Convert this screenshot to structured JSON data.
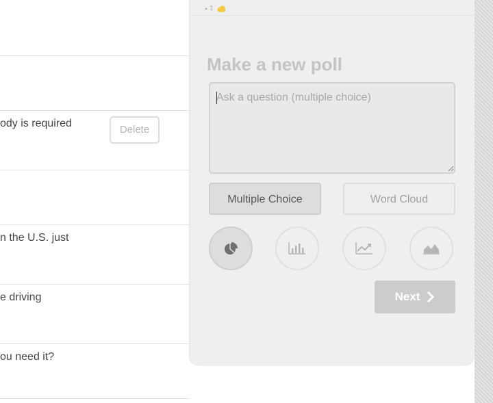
{
  "list": {
    "rows": [
      {
        "text": ""
      },
      {
        "text": ""
      },
      {
        "text": "ody is required",
        "action": "Delete"
      },
      {
        "text": ""
      },
      {
        "text": "n the U.S. just"
      },
      {
        "text": "e driving"
      },
      {
        "text": "ou need it?"
      }
    ]
  },
  "panel": {
    "meta": {
      "caret": "▲",
      "count": "1",
      "icon": "cloud-icon"
    },
    "title": "Make a new poll",
    "question_placeholder": "Ask a question (multiple choice)",
    "question_value": "",
    "types": {
      "multiple_choice": "Multiple Choice",
      "word_cloud": "Word Cloud",
      "selected": "Multiple Choice"
    },
    "chart_types": [
      {
        "icon": "pie-chart-icon",
        "selected": true
      },
      {
        "icon": "bar-chart-icon",
        "selected": false
      },
      {
        "icon": "line-chart-icon",
        "selected": false
      },
      {
        "icon": "area-chart-icon",
        "selected": false
      }
    ],
    "next_label": "Next"
  },
  "colors": {
    "accent_cloud": "#f5c842",
    "panel_bg": "#efefef"
  }
}
